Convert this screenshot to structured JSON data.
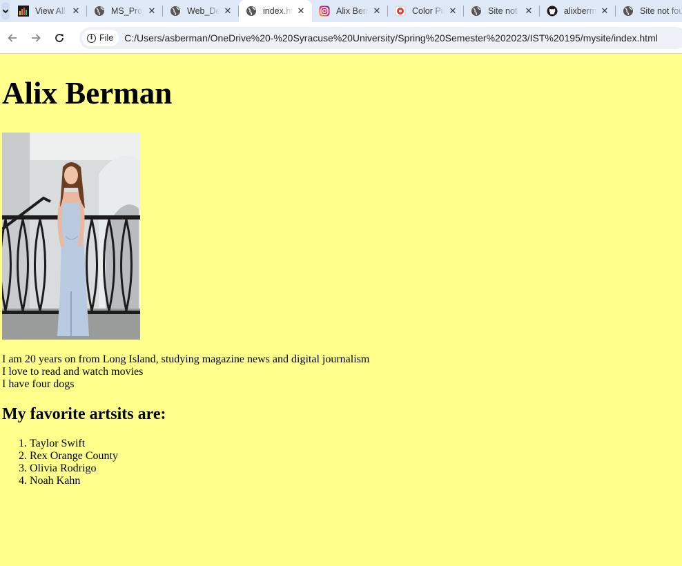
{
  "tabs": [
    {
      "title": "View All",
      "icon": "bar-chart-icon",
      "active": false
    },
    {
      "title": "MS_Proj",
      "icon": "globe-icon",
      "active": false
    },
    {
      "title": "Web_Des",
      "icon": "globe-icon",
      "active": false
    },
    {
      "title": "index.html",
      "icon": "globe-icon",
      "active": true
    },
    {
      "title": "Alix Berman",
      "icon": "instagram-icon",
      "active": false
    },
    {
      "title": "Color Picker",
      "icon": "color-picker-icon",
      "active": false
    },
    {
      "title": "Site not found",
      "icon": "globe-icon",
      "active": false
    },
    {
      "title": "alixberman",
      "icon": "github-icon",
      "active": false
    },
    {
      "title": "Site not found",
      "icon": "globe-icon",
      "active": false
    }
  ],
  "toolbar": {
    "chip_label": "File",
    "url": "C:/Users/asberman/OneDrive%20-%20Syracuse%20University/Spring%20Semester%202023/IST%20195/mysite/index.html"
  },
  "page": {
    "heading": "Alix Berman",
    "bio_lines": [
      "I am 20 years on from Long Island, studying magazine news and digital journalism",
      "I love to read and watch movies",
      "I have four dogs"
    ],
    "artists_heading": "My favorite artsits are:",
    "artists": [
      "Taylor Swift",
      "Rex Orange County",
      "Olivia Rodrigo",
      "Noah Kahn"
    ]
  },
  "colors": {
    "page_background": "#ffff8c",
    "tabstrip": "#dfe8f7"
  }
}
